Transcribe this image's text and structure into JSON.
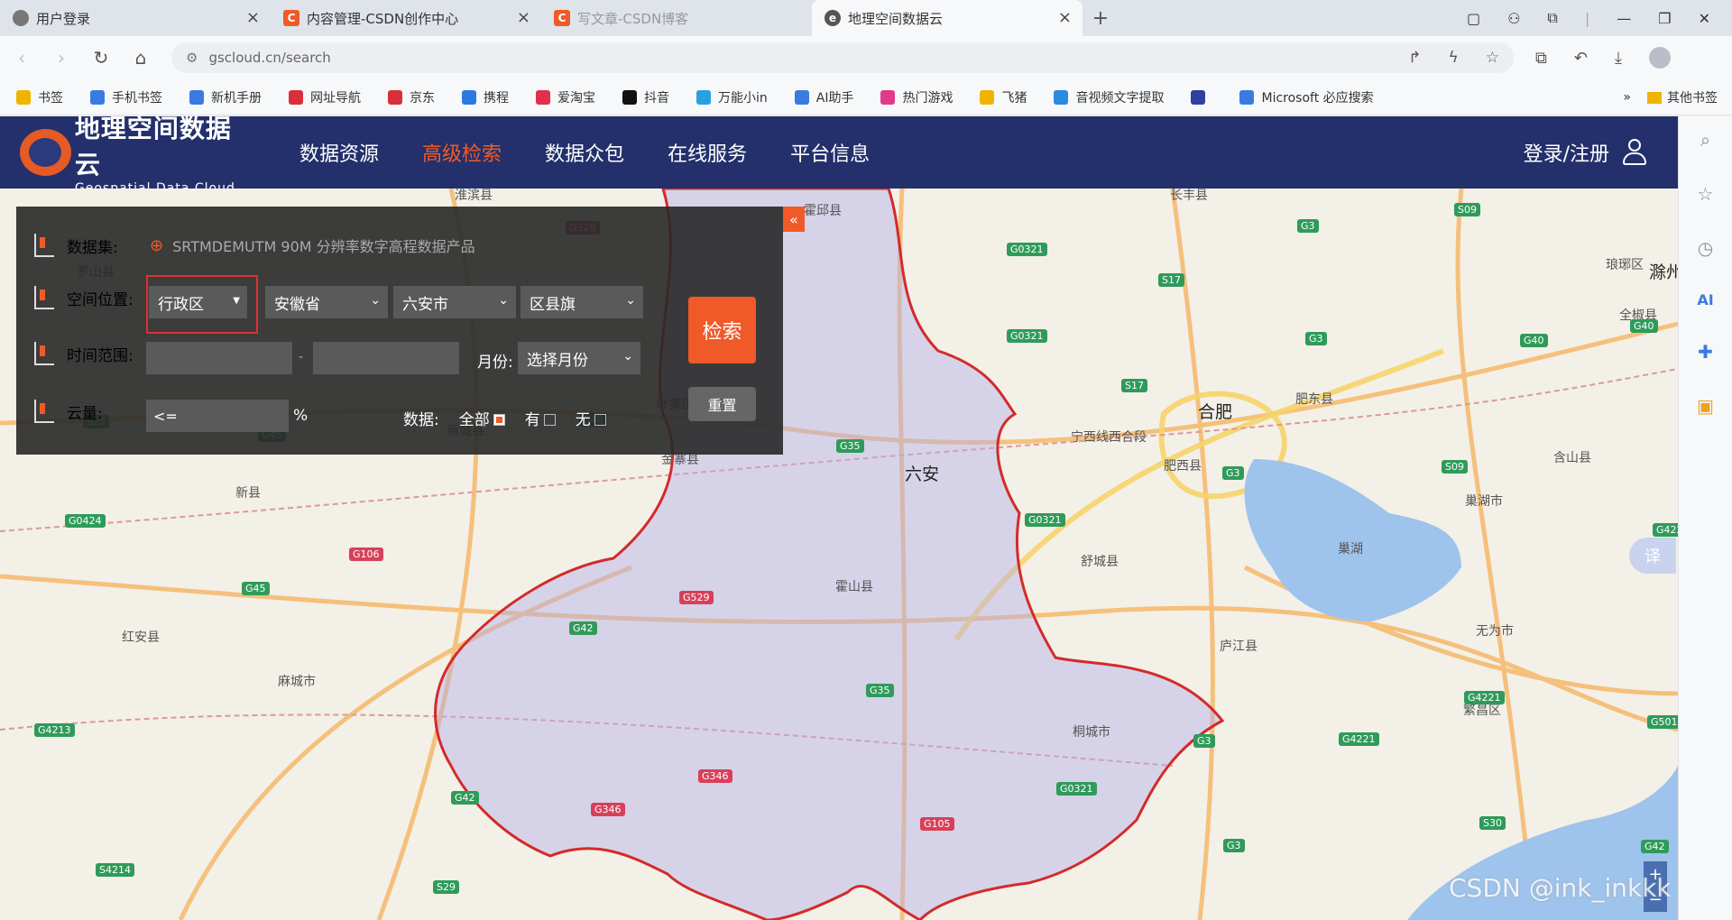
{
  "browser": {
    "tabs": [
      {
        "title": "用户登录",
        "color": "#777777"
      },
      {
        "title": "内容管理-CSDN创作中心",
        "color": "#f05a28"
      },
      {
        "title": "写文章-CSDN博客",
        "color": "#f05a28"
      },
      {
        "title": "地理空间数据云",
        "color": "#555555"
      }
    ],
    "url": "gscloud.cn/search",
    "bookmarks": [
      {
        "label": "书签",
        "color": "#f0b400"
      },
      {
        "label": "手机书签",
        "color": "#3a7be0"
      },
      {
        "label": "新机手册",
        "color": "#3a7be0"
      },
      {
        "label": "网址导航",
        "color": "#d8303a"
      },
      {
        "label": "京东",
        "color": "#d8303a"
      },
      {
        "label": "携程",
        "color": "#2a7be0"
      },
      {
        "label": "爱淘宝",
        "color": "#e0304a"
      },
      {
        "label": "抖音",
        "color": "#111111"
      },
      {
        "label": "万能小in",
        "color": "#2aa0e0"
      },
      {
        "label": "AI助手",
        "color": "#3a7be0"
      },
      {
        "label": "热门游戏",
        "color": "#e03a8a"
      },
      {
        "label": "飞猪",
        "color": "#f0b400"
      },
      {
        "label": "音视频文字提取",
        "color": "#2a8be0"
      },
      {
        "label": "",
        "color": "#3040a0"
      },
      {
        "label": "Microsoft 必应搜索",
        "color": "#3a7be0"
      }
    ],
    "bookmark_more": "»",
    "other_bookmarks": "其他书签"
  },
  "site": {
    "logo_cn": "地理空间数据云",
    "logo_en": "Geospatial Data Cloud",
    "nav": [
      {
        "label": "数据资源",
        "active": false
      },
      {
        "label": "高级检索",
        "active": true
      },
      {
        "label": "数据众包",
        "active": false
      },
      {
        "label": "在线服务",
        "active": false
      },
      {
        "label": "平台信息",
        "active": false
      }
    ],
    "login": "登录/注册"
  },
  "panel": {
    "dataset_label": "数据集:",
    "dataset_value": "SRTMDEMUTM 90M 分辨率数字高程数据产品",
    "location_label": "空间位置:",
    "region_type": "行政区",
    "province": "安徽省",
    "city": "六安市",
    "county": "区县旗",
    "time_label": "时间范围:",
    "time_sep": "-",
    "month_label": "月份:",
    "month_value": "选择月份",
    "cloud_label": "云量:",
    "cloud_value": "<=",
    "cloud_unit": "%",
    "data_label": "数据:",
    "opt_all": "全部",
    "opt_has": "有",
    "opt_none": "无",
    "search_btn": "检索",
    "reset_btn": "重置",
    "collapse": "«"
  },
  "map": {
    "labels": [
      {
        "t": "淮滨县",
        "big": false
      },
      {
        "t": "霍邱县",
        "big": false
      },
      {
        "t": "长丰县",
        "big": false
      },
      {
        "t": "琅琊区",
        "big": false
      },
      {
        "t": "滁州",
        "big": true
      },
      {
        "t": "全椒县",
        "big": false
      },
      {
        "t": "罗山县",
        "big": false
      },
      {
        "t": "商城县",
        "big": false
      },
      {
        "t": "叶集区",
        "big": false
      },
      {
        "t": "合肥",
        "big": true
      },
      {
        "t": "肥东县",
        "big": false
      },
      {
        "t": "金寨县",
        "big": false
      },
      {
        "t": "六安",
        "big": true
      },
      {
        "t": "宁西线西合段",
        "big": false
      },
      {
        "t": "肥西县",
        "big": false
      },
      {
        "t": "含山县",
        "big": false
      },
      {
        "t": "新县",
        "big": false
      },
      {
        "t": "巢湖市",
        "big": false
      },
      {
        "t": "巢湖",
        "big": false
      },
      {
        "t": "霍山县",
        "big": false
      },
      {
        "t": "舒城县",
        "big": false
      },
      {
        "t": "红安县",
        "big": false
      },
      {
        "t": "无为市",
        "big": false
      },
      {
        "t": "庐江县",
        "big": false
      },
      {
        "t": "麻城市",
        "big": false
      },
      {
        "t": "桐城市",
        "big": false
      },
      {
        "t": "繁昌区",
        "big": false
      }
    ],
    "shields": [
      {
        "t": "G328",
        "red": true
      },
      {
        "t": "G3",
        "red": false
      },
      {
        "t": "S09",
        "red": false
      },
      {
        "t": "G0321",
        "red": false
      },
      {
        "t": "S17",
        "red": false
      },
      {
        "t": "G3",
        "red": false
      },
      {
        "t": "G0321",
        "red": false
      },
      {
        "t": "S17",
        "red": false
      },
      {
        "t": "G40",
        "red": false
      },
      {
        "t": "G40",
        "red": false
      },
      {
        "t": "S25",
        "red": false
      },
      {
        "t": "G45",
        "red": false
      },
      {
        "t": "G40",
        "red": false
      },
      {
        "t": "G35",
        "red": false
      },
      {
        "t": "S09",
        "red": false
      },
      {
        "t": "G3",
        "red": false
      },
      {
        "t": "G0424",
        "red": false
      },
      {
        "t": "G106",
        "red": true
      },
      {
        "t": "G0321",
        "red": false
      },
      {
        "t": "G4221",
        "red": false
      },
      {
        "t": "G45",
        "red": false
      },
      {
        "t": "G529",
        "red": true
      },
      {
        "t": "G42",
        "red": false
      },
      {
        "t": "G35",
        "red": false
      },
      {
        "t": "G4221",
        "red": false
      },
      {
        "t": "G4213",
        "red": false
      },
      {
        "t": "G3",
        "red": false
      },
      {
        "t": "G4221",
        "red": false
      },
      {
        "t": "G5011",
        "red": false
      },
      {
        "t": "G346",
        "red": true
      },
      {
        "t": "G42",
        "red": false
      },
      {
        "t": "G346",
        "red": true
      },
      {
        "t": "G0321",
        "red": false
      },
      {
        "t": "S30",
        "red": false
      },
      {
        "t": "G105",
        "red": true
      },
      {
        "t": "S4214",
        "red": false
      },
      {
        "t": "G3",
        "red": false
      },
      {
        "t": "S29",
        "red": false
      },
      {
        "t": "G42",
        "red": false
      }
    ],
    "translate": "译",
    "watermark": "CSDN @ink_inkkk"
  }
}
